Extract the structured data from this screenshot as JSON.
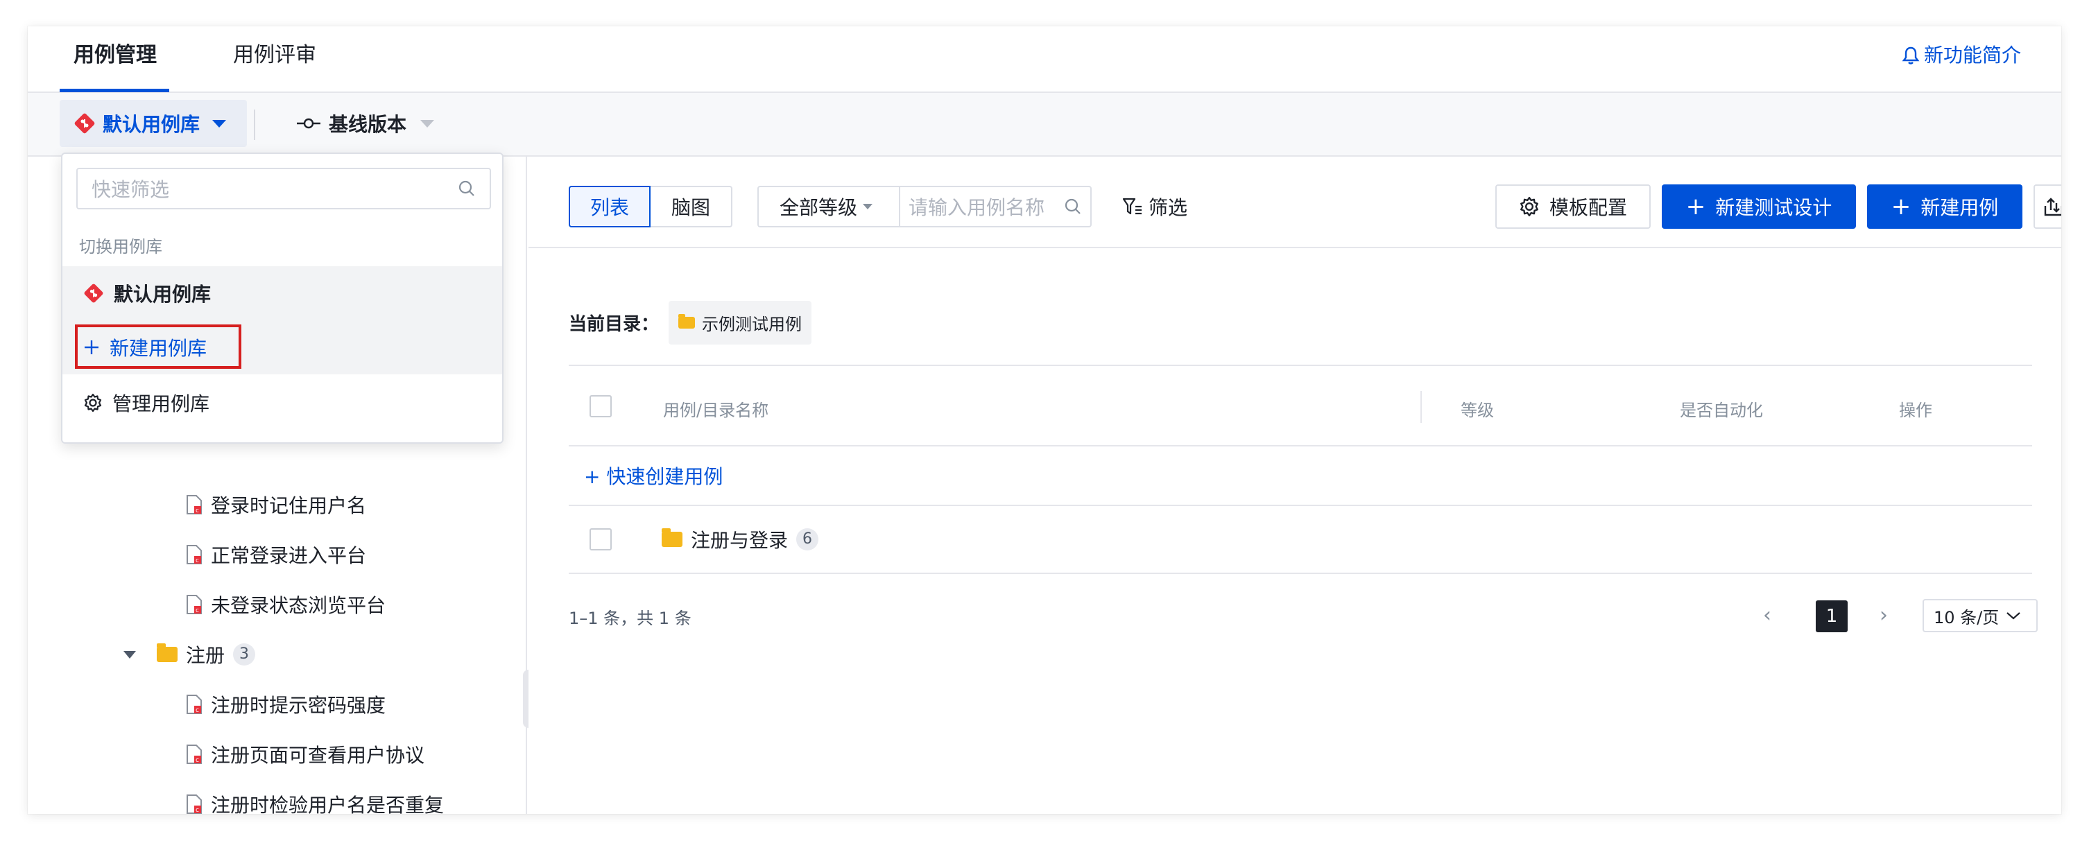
{
  "tabs": [
    {
      "label": "用例管理",
      "active": true
    },
    {
      "label": "用例评审",
      "active": false
    }
  ],
  "whats_new": "新功能简介",
  "library_select": {
    "label": "默认用例库"
  },
  "baseline_select": {
    "label": "基线版本"
  },
  "dropdown": {
    "search_placeholder": "快速筛选",
    "section_title": "切换用例库",
    "current_library": "默认用例库",
    "new_library": "新建用例库",
    "manage_library": "管理用例库"
  },
  "tree": {
    "login_cases": [
      "登录时记住用户名",
      "正常登录进入平台",
      "未登录状态浏览平台"
    ],
    "register_folder": {
      "label": "注册",
      "count": "3"
    },
    "register_cases": [
      "注册时提示密码强度",
      "注册页面可查看用户协议",
      "注册时检验用户名是否重复"
    ]
  },
  "toolbar": {
    "view_list": "列表",
    "view_mindmap": "脑图",
    "level_select": "全部等级",
    "name_search_placeholder": "请输入用例名称",
    "filter": "筛选",
    "template_config": "模板配置",
    "new_test_design": "新建测试设计",
    "new_case": "新建用例"
  },
  "current_dir": {
    "label": "当前目录：",
    "value": "示例测试用例"
  },
  "table": {
    "headers": [
      "用例/目录名称",
      "等级",
      "是否自动化",
      "操作"
    ],
    "quick_create": "+ 快速创建用例",
    "rows": [
      {
        "name": "注册与登录",
        "count": "6"
      }
    ]
  },
  "pagination": {
    "total": "1–1 条，共 1 条",
    "current_page": "1",
    "page_size": "10 条/页"
  },
  "colors": {
    "primary": "#0052d9",
    "highlight_box": "#d61f1f",
    "folder": "#f5b81c"
  }
}
